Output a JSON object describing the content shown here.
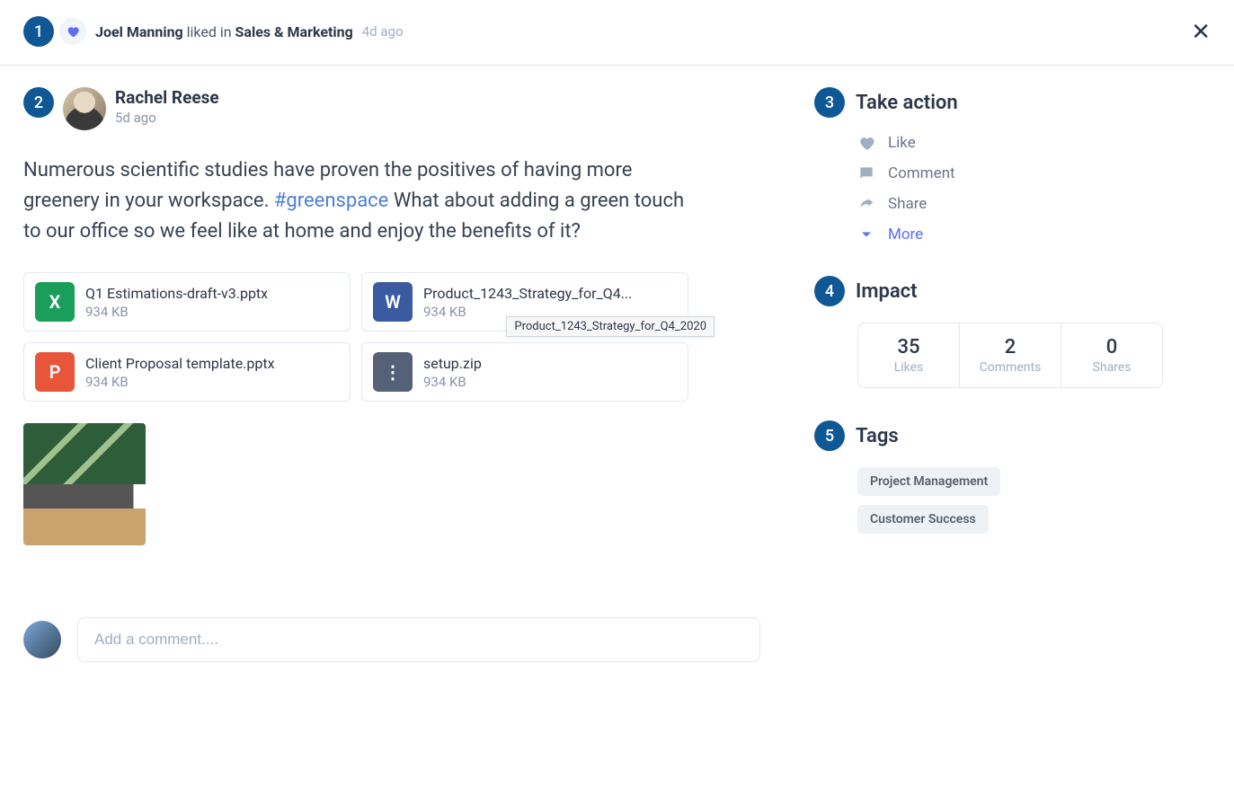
{
  "header": {
    "liker_name": "Joel Manning",
    "verb": " liked in ",
    "channel": "Sales & Marketing",
    "time": "4d ago"
  },
  "post": {
    "author": "Rachel Reese",
    "time": "5d ago",
    "body_before_tag": "Numerous scientific studies have proven the positives of having more greenery in your workspace. ",
    "hashtag": "#greenspace",
    "body_after_tag": " What about adding a green touch to our office so we feel like at home and enjoy the benefits of it?"
  },
  "attachments": [
    {
      "name": "Q1 Estimations-draft-v3.pptx",
      "size": "934 KB",
      "icon": "X",
      "cls": "fi-excel"
    },
    {
      "name": "Product_1243_Strategy_for_Q4...",
      "size": "934 KB",
      "icon": "W",
      "cls": "fi-word",
      "tooltip": "Product_1243_Strategy_for_Q4_2020"
    },
    {
      "name": "Client Proposal template.pptx",
      "size": "934 KB",
      "icon": "P",
      "cls": "fi-ppt"
    },
    {
      "name": "setup.zip",
      "size": "934 KB",
      "icon": "⋮",
      "cls": "fi-zip"
    }
  ],
  "comment": {
    "placeholder": "Add a comment...."
  },
  "sidebar": {
    "take_action": {
      "title": "Take action",
      "like": "Like",
      "comment": "Comment",
      "share": "Share",
      "more": "More"
    },
    "impact": {
      "title": "Impact",
      "cells": [
        {
          "num": "35",
          "label": "Likes"
        },
        {
          "num": "2",
          "label": "Comments"
        },
        {
          "num": "0",
          "label": "Shares"
        }
      ]
    },
    "tags": {
      "title": "Tags",
      "items": [
        "Project Management",
        "Customer Success"
      ]
    }
  },
  "badges": {
    "n1": "1",
    "n2": "2",
    "n3": "3",
    "n4": "4",
    "n5": "5"
  }
}
